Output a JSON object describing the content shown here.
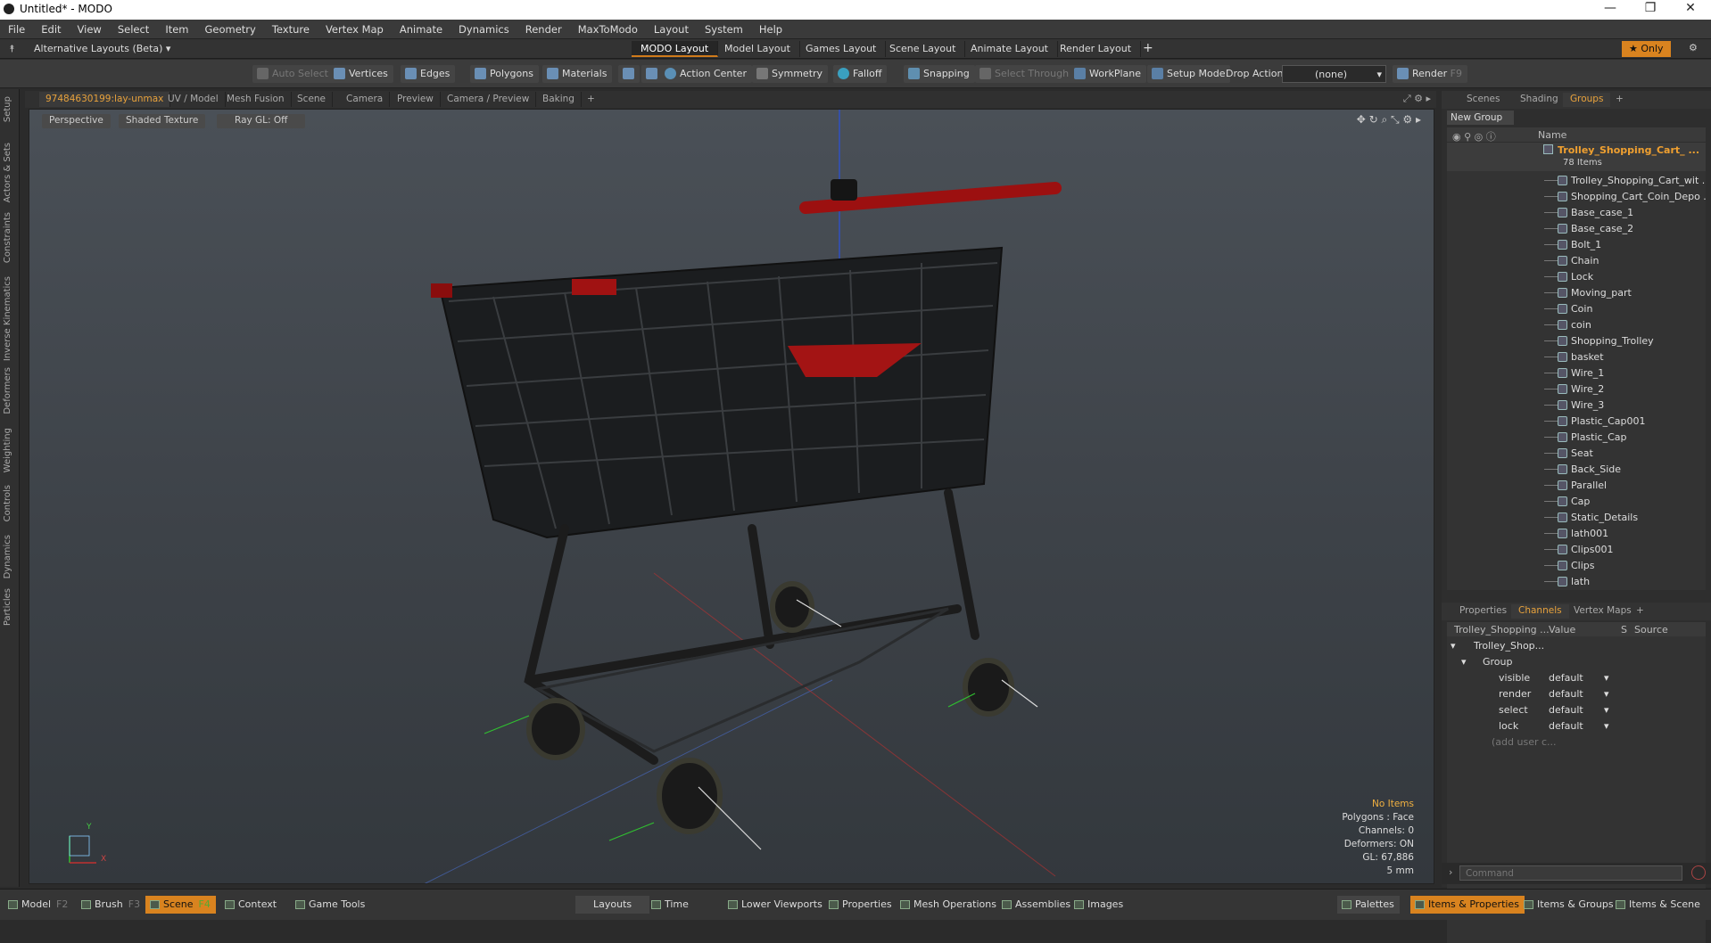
{
  "window": {
    "title": "Untitled* - MODO",
    "minimize": "—",
    "maximize": "❐",
    "close": "✕"
  },
  "menu": [
    "File",
    "Edit",
    "View",
    "Select",
    "Item",
    "Geometry",
    "Texture",
    "Vertex Map",
    "Animate",
    "Dynamics",
    "Render",
    "MaxToModo",
    "Layout",
    "System",
    "Help"
  ],
  "layoutbar": {
    "layouts_label": "Alternative Layouts (Beta)",
    "tabs": [
      "MODO Layout",
      "Model Layout",
      "Games Layout",
      "Scene Layout",
      "Animate Layout",
      "Render Layout"
    ],
    "add": "+",
    "only": "★ Only"
  },
  "toolbar": {
    "auto_select": "Auto Select",
    "vertices": "Vertices",
    "edges": "Edges",
    "polygons": "Polygons",
    "materials": "Materials",
    "action_center": "Action Center",
    "symmetry": "Symmetry",
    "falloff": "Falloff",
    "snapping": "Snapping",
    "select_through": "Select Through",
    "workplane": "WorkPlane",
    "setup_mode": "Setup Mode",
    "drop_action": "Drop Action",
    "drop_value": "(none)",
    "render": "Render",
    "render_key": "F9"
  },
  "left_tabs": [
    "Setup",
    "Actors & Sets",
    "Constraints",
    "Inverse Kinematics",
    "Deformers",
    "Weighting",
    "Controls",
    "Dynamics",
    "Particles"
  ],
  "viewport_tabs": [
    "97484630199:lay-unmax",
    "UV / Model",
    "Mesh Fusion",
    "Scene",
    "Camera",
    "Preview",
    "Camera / Preview",
    "Baking",
    "+"
  ],
  "viewport": {
    "perspective": "Perspective",
    "shading": "Shaded Texture",
    "raygl": "Ray GL: Off",
    "info": {
      "items": "No Items",
      "polygons": "Polygons : Face",
      "channels": "Channels: 0",
      "deformers": "Deformers: ON",
      "gl": "GL: 67,886",
      "unit": "5 mm"
    },
    "axis_y": "Y",
    "axis_x": "X"
  },
  "right_tabs": [
    "Scenes",
    "Shading",
    "Groups",
    "+"
  ],
  "groups": {
    "new_group": "New Group",
    "name_header": "Name",
    "root": "Trolley_Shopping_Cart_ ...",
    "root_count": "78 Items",
    "items": [
      "Trolley_Shopping_Cart_wit ...",
      "Shopping_Cart_Coin_Depo ...",
      "Base_case_1",
      "Base_case_2",
      "Bolt_1",
      "Chain",
      "Lock",
      "Moving_part",
      "Coin",
      "coin",
      "Shopping_Trolley",
      "basket",
      "Wire_1",
      "Wire_2",
      "Wire_3",
      "Plastic_Cap001",
      "Plastic_Cap",
      "Seat",
      "Back_Side",
      "Parallel",
      "Cap",
      "Static_Details",
      "lath001",
      "Clips001",
      "Clips",
      "lath"
    ]
  },
  "channels": {
    "tabs": [
      "Properties",
      "Channels",
      "Vertex Maps",
      "+"
    ],
    "col_name": "Trolley_Shopping ...",
    "col_value": "Value",
    "col_s": "S",
    "col_source": "Source",
    "root": "Trolley_Shop...",
    "group": "Group",
    "rows": [
      {
        "name": "visible",
        "value": "default"
      },
      {
        "name": "render",
        "value": "default"
      },
      {
        "name": "select",
        "value": "default"
      },
      {
        "name": "lock",
        "value": "default"
      }
    ],
    "add": "(add user c..."
  },
  "command": {
    "placeholder": "Command"
  },
  "bottom": {
    "model": "Model",
    "model_key": "F2",
    "brush": "Brush",
    "brush_key": "F3",
    "scene": "Scene",
    "scene_key": "F4",
    "context": "Context",
    "game_tools": "Game Tools",
    "layouts": "Layouts",
    "time": "Time",
    "lower_viewports": "Lower Viewports",
    "properties": "Properties",
    "mesh_operations": "Mesh Operations",
    "assemblies": "Assemblies",
    "images": "Images",
    "palettes": "Palettes",
    "items_properties": "Items & Properties",
    "items_groups": "Items & Groups",
    "items_scene": "Items & Scene"
  }
}
